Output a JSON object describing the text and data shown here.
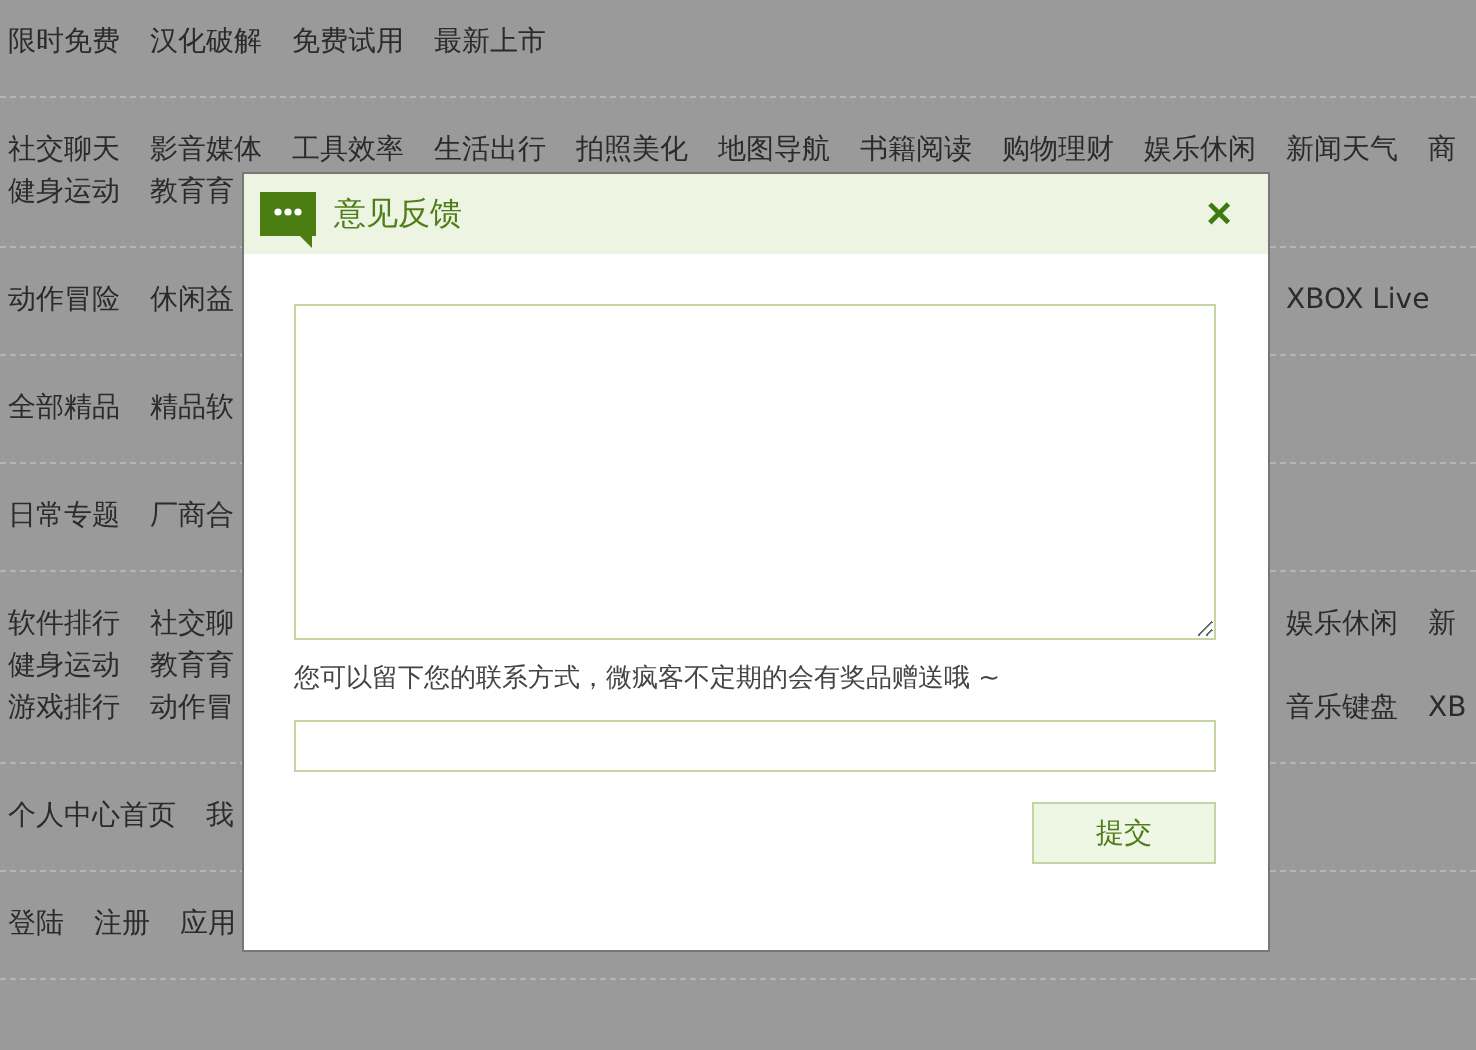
{
  "nav_sections": [
    {
      "lines": [
        {
          "left": [
            "限时免费",
            "汉化破解",
            "免费试用",
            "最新上市"
          ]
        }
      ]
    },
    {
      "lines": [
        {
          "left": [
            "社交聊天",
            "影音媒体",
            "工具效率",
            "生活出行",
            "拍照美化",
            "地图导航",
            "书籍阅读",
            "购物理财",
            "娱乐休闲",
            "新闻天气",
            "商"
          ]
        },
        {
          "left": [
            "健身运动",
            "教育育"
          ]
        }
      ]
    },
    {
      "lines": [
        {
          "left": [
            "动作冒险",
            "休闲益"
          ],
          "right": [
            "XBOX Live"
          ]
        }
      ]
    },
    {
      "lines": [
        {
          "left": [
            "全部精品",
            "精品软"
          ]
        }
      ]
    },
    {
      "lines": [
        {
          "left": [
            "日常专题",
            "厂商合"
          ]
        }
      ]
    },
    {
      "lines": [
        {
          "left": [
            "软件排行",
            "社交聊"
          ],
          "right": [
            "娱乐休闲",
            "新"
          ]
        },
        {
          "left": [
            "健身运动",
            "教育育"
          ]
        },
        {
          "left": [
            "游戏排行",
            "动作冒"
          ],
          "right": [
            "音乐键盘",
            "XB"
          ]
        }
      ]
    },
    {
      "lines": [
        {
          "left": [
            "个人中心首页",
            "我"
          ]
        }
      ]
    },
    {
      "lines": [
        {
          "left": [
            "登陆",
            "注册",
            "应用"
          ]
        }
      ]
    }
  ],
  "dialog": {
    "title": "意见反馈",
    "close": "×",
    "hint": "您可以留下您的联系方式，微疯客不定期的会有奖品赠送哦 ~",
    "submit": "提交"
  }
}
